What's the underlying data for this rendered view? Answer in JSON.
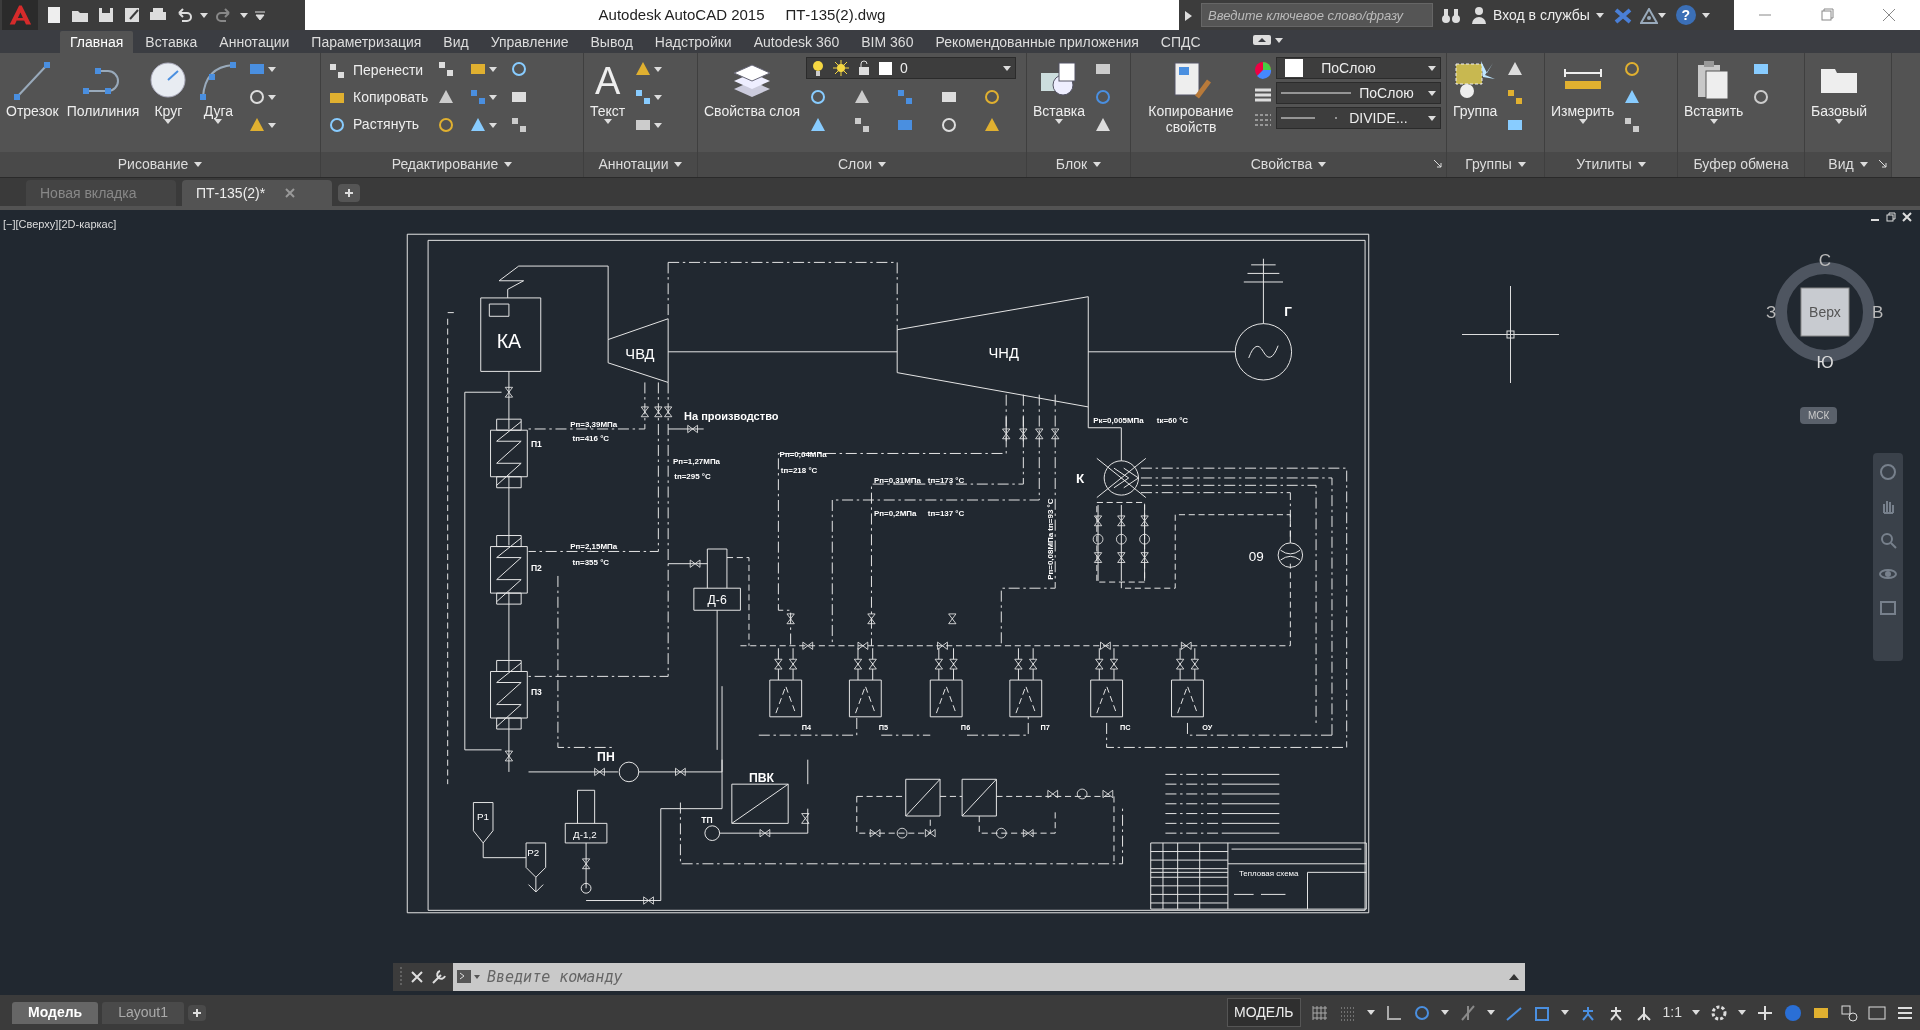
{
  "title_bar": {
    "title": "Autodesk AutoCAD 2015",
    "file": "ПТ-135(2).dwg",
    "search": {
      "placeholder": "Введите ключевое слово/фразу"
    },
    "sign_in": "Вход в службы",
    "help": "?"
  },
  "ribbon_tabs": [
    {
      "label": "Главная",
      "selected": true
    },
    {
      "label": "Вставка",
      "selected": false
    },
    {
      "label": "Аннотации",
      "selected": false
    },
    {
      "label": "Параметризация",
      "selected": false
    },
    {
      "label": "Вид",
      "selected": false
    },
    {
      "label": "Управление",
      "selected": false
    },
    {
      "label": "Вывод",
      "selected": false
    },
    {
      "label": "Надстройки",
      "selected": false
    },
    {
      "label": "Autodesk 360",
      "selected": false
    },
    {
      "label": "BIM 360",
      "selected": false
    },
    {
      "label": "Рекомендованные приложения",
      "selected": false
    },
    {
      "label": "СПДС",
      "selected": false
    }
  ],
  "ribbon_panels": [
    {
      "title": "Рисование",
      "tools": [
        {
          "kind": "big",
          "label": "Отрезок"
        },
        {
          "kind": "big",
          "label": "Полилиния"
        },
        {
          "kind": "big",
          "label": "Круг"
        },
        {
          "kind": "big",
          "label": "Дуга"
        }
      ]
    },
    {
      "title": "Редактирование",
      "tools": [
        {
          "kind": "row",
          "label": "Перенести"
        },
        {
          "kind": "row",
          "label": "Копировать"
        },
        {
          "kind": "row",
          "label": "Растянуть"
        }
      ]
    },
    {
      "title": "Аннотации",
      "tools": [
        {
          "kind": "big",
          "label": "Текст",
          "glyph": "A"
        }
      ]
    },
    {
      "title": "Слои",
      "tools": [
        {
          "kind": "big",
          "label": "Свойства слоя"
        },
        {
          "kind": "layer",
          "label": "0"
        }
      ]
    },
    {
      "title": "Блок",
      "tools": [
        {
          "kind": "big",
          "label": "Вставка"
        }
      ]
    },
    {
      "title": "Свойства",
      "tools": [
        {
          "kind": "big",
          "label": "Копирование свойств"
        },
        {
          "kind": "combo",
          "label": "ПоСлою"
        },
        {
          "kind": "combo",
          "label": "ПоСлою"
        },
        {
          "kind": "combo",
          "label": "DIVIDE..."
        }
      ]
    },
    {
      "title": "Группы",
      "tools": [
        {
          "kind": "big",
          "label": "Группа"
        }
      ]
    },
    {
      "title": "Утилиты",
      "tools": [
        {
          "kind": "big",
          "label": "Измерить"
        }
      ]
    },
    {
      "title": "Буфер обмена",
      "tools": [
        {
          "kind": "big",
          "label": "Вставить"
        }
      ]
    },
    {
      "title": "Вид",
      "tools": [
        {
          "kind": "big",
          "label": "Базовый"
        }
      ]
    }
  ],
  "document_tabs": [
    {
      "label": "Новая вкладка",
      "selected": false
    },
    {
      "label": "ПТ-135(2)*",
      "selected": true
    }
  ],
  "viewport_label": "[−][Сверху][2D-каркас]",
  "view_cube": {
    "north": "С",
    "west": "З",
    "east": "В",
    "south": "Ю",
    "face": "Верх",
    "ucs": "МСК"
  },
  "drawing": {
    "labels": [
      "КА",
      "ЧВД",
      "ЧНД",
      "Г",
      "На производство",
      "Pп=3,39МПа",
      "tп=416 °C",
      "П1",
      "Pп=1,27МПа",
      "tп=295 °C",
      "Pп=0,64МПа",
      "tп=218 °C",
      "Pп=0,31МПа",
      "tп=173 °C",
      "Pп=0,2МПа",
      "tп=137 °C",
      "Pк=0,005МПа",
      "tк=60 °C",
      "К",
      "Pп=0,08МПа  tп=93 °C",
      "П2",
      "Pп=2,15МПа",
      "tп=355 °C",
      "Д-6",
      "09",
      "П3",
      "П4",
      "П5",
      "П6",
      "П7",
      "ПС",
      "ОУ",
      "ПН",
      "ПВК",
      "ТП",
      "Р1",
      "Р2",
      "Д-1,2",
      "Тепловая схема"
    ]
  },
  "command_line": {
    "placeholder": "Введите команду"
  },
  "layout_tabs": [
    {
      "label": "Модель",
      "selected": true
    },
    {
      "label": "Layout1",
      "selected": false
    }
  ],
  "status_bar": {
    "space": "МОДЕЛЬ",
    "scale": "1:1"
  }
}
